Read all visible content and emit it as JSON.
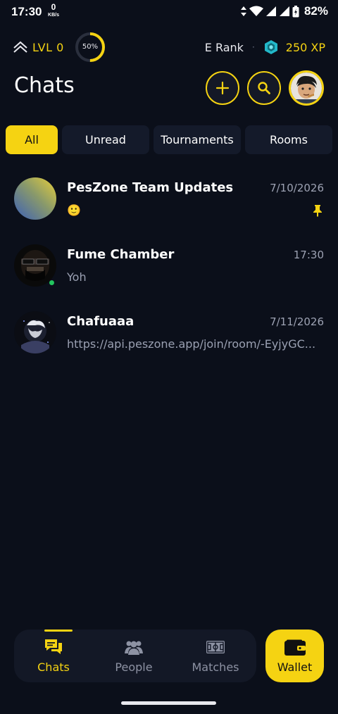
{
  "status_bar": {
    "time": "17:30",
    "net_speed_value": "0",
    "net_speed_unit": "KB/s",
    "battery": "82%"
  },
  "profile": {
    "level": "LVL 0",
    "progress_percent": 50,
    "progress_label": "50%",
    "rank": "E Rank",
    "separator": "·",
    "xp": "250 XP"
  },
  "header": {
    "title": "Chats"
  },
  "tabs": [
    {
      "label": "All",
      "active": true
    },
    {
      "label": "Unread",
      "active": false
    },
    {
      "label": "Tournaments",
      "active": false
    },
    {
      "label": "Rooms",
      "active": false
    }
  ],
  "chats": [
    {
      "name": "PesZone Team Updates",
      "time": "7/10/2026",
      "message": "🙂",
      "pinned": true,
      "online": false
    },
    {
      "name": "Fume Chamber",
      "time": "17:30",
      "message": "Yoh",
      "pinned": false,
      "online": true
    },
    {
      "name": "Chafuaaa",
      "time": "7/11/2026",
      "message": "https://api.peszone.app/join/room/-EyjyGC...",
      "pinned": false,
      "online": false
    }
  ],
  "bottom_nav": {
    "items": [
      {
        "label": "Chats",
        "icon": "chat-bubbles-icon",
        "active": true
      },
      {
        "label": "People",
        "icon": "people-icon",
        "active": false
      },
      {
        "label": "Matches",
        "icon": "pitch-icon",
        "active": false
      }
    ],
    "wallet": {
      "label": "Wallet",
      "icon": "wallet-icon"
    }
  },
  "colors": {
    "accent": "#f5d312",
    "background": "#0b0f1a",
    "surface": "#141a2a",
    "online": "#22c55e"
  }
}
